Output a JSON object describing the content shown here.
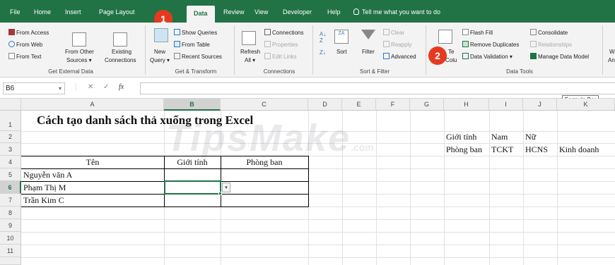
{
  "tabs": {
    "file": "File",
    "home": "Home",
    "insert": "Insert",
    "page_layout": "Page Layout",
    "data": "Data",
    "review": "Review",
    "view": "View",
    "developer": "Developer",
    "help": "Help",
    "tell_me": "Tell me what you want to do"
  },
  "ribbon": {
    "get_external": {
      "from_access": "From Access",
      "from_web": "From Web",
      "from_text": "From Text",
      "from_other_1": "From Other",
      "from_other_2": "Sources ▾",
      "existing_1": "Existing",
      "existing_2": "Connections",
      "label": "Get External Data"
    },
    "get_transform": {
      "new_query_1": "New",
      "new_query_2": "Query ▾",
      "show_queries": "Show Queries",
      "from_table": "From Table",
      "recent_sources": "Recent Sources",
      "label": "Get & Transform"
    },
    "connections": {
      "refresh_1": "Refresh",
      "refresh_2": "All ▾",
      "connections": "Connections",
      "properties": "Properties",
      "edit_links": "Edit Links",
      "label": "Connections"
    },
    "sort_filter": {
      "sort": "Sort",
      "filter": "Filter",
      "clear": "Clear",
      "reapply": "Reapply",
      "advanced": "Advanced",
      "label": "Sort & Filter"
    },
    "data_tools": {
      "text_to_1": "Te",
      "text_to_2": "Colu",
      "flash_fill": "Flash Fill",
      "remove_duplicates": "Remove Duplicates",
      "data_validation": "Data Validation",
      "consolidate": "Consolidate",
      "relationships": "Relationships",
      "manage_data_model": "Manage Data Model",
      "label": "Data Tools"
    },
    "whatif_1": "W",
    "whatif_2": "An"
  },
  "formula_bar": {
    "name_box": "B6",
    "fx": "fx",
    "tooltip": "Formula Bar"
  },
  "columns": [
    "A",
    "B",
    "C",
    "D",
    "E",
    "F",
    "G",
    "H",
    "I",
    "J",
    "K"
  ],
  "rows": [
    "1",
    "2",
    "3",
    "4",
    "5",
    "6",
    "7",
    "8",
    "9",
    "10",
    "11"
  ],
  "sheet": {
    "title": "Cách tạo danh sách thả xuống trong Excel",
    "header_ten": "Tên",
    "header_gioitinh": "Giới tính",
    "header_phongban": "Phòng ban",
    "name1": "Nguyễn văn A",
    "name2": "Phạm Thị M",
    "name3": "Trần Kim C",
    "h2": "Giới tính",
    "i2": "Nam",
    "j2": "Nữ",
    "h3": "Phòng ban",
    "i3": "TCKT",
    "j3": "HCNS",
    "k3": "Kinh doanh"
  },
  "watermark": "TipsMake",
  "watermark_com": ".com",
  "annotations": {
    "step1": "1",
    "step2": "2"
  },
  "colors": {
    "excel_green": "#217346",
    "badge_red": "#e53a1f"
  }
}
